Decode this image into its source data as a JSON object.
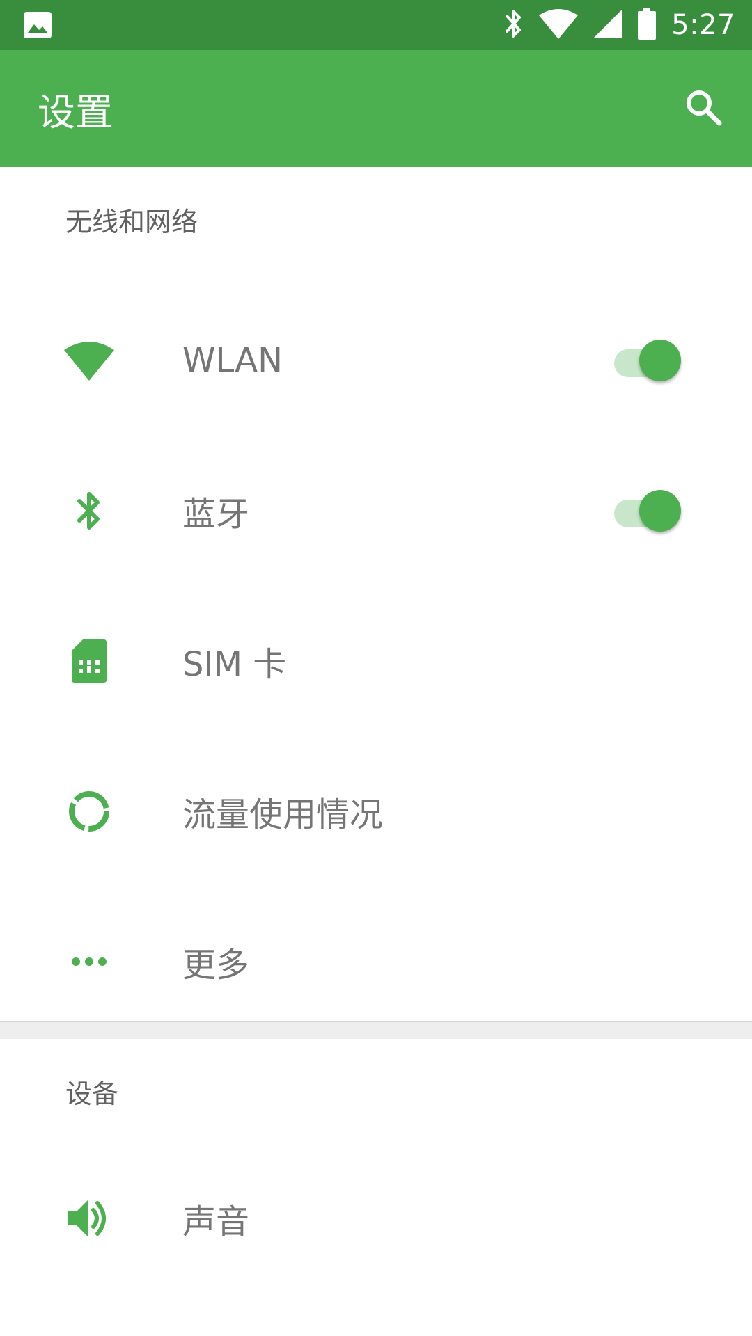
{
  "status_bar": {
    "time": "5:27",
    "icons": [
      "image-icon",
      "bluetooth-icon",
      "wifi-icon",
      "cell-signal-icon",
      "battery-icon"
    ]
  },
  "toolbar": {
    "title": "设置",
    "search_icon": "search-icon"
  },
  "sections": [
    {
      "header": "无线和网络",
      "items": [
        {
          "label": "WLAN",
          "icon": "wifi-icon",
          "toggle": true
        },
        {
          "label": "蓝牙",
          "icon": "bluetooth-icon",
          "toggle": true
        },
        {
          "label": "SIM 卡",
          "icon": "sim-card-icon"
        },
        {
          "label": "流量使用情况",
          "icon": "data-usage-icon"
        },
        {
          "label": "更多",
          "icon": "more-horiz-icon"
        }
      ]
    },
    {
      "header": "设备",
      "items": [
        {
          "label": "声音",
          "icon": "volume-icon"
        }
      ]
    }
  ],
  "colors": {
    "status_bar": "#388E3C",
    "toolbar": "#4CAF50",
    "accent": "#4CAF50",
    "switch_track": "#C8E6C9",
    "label": "#757575",
    "header": "#616161"
  }
}
